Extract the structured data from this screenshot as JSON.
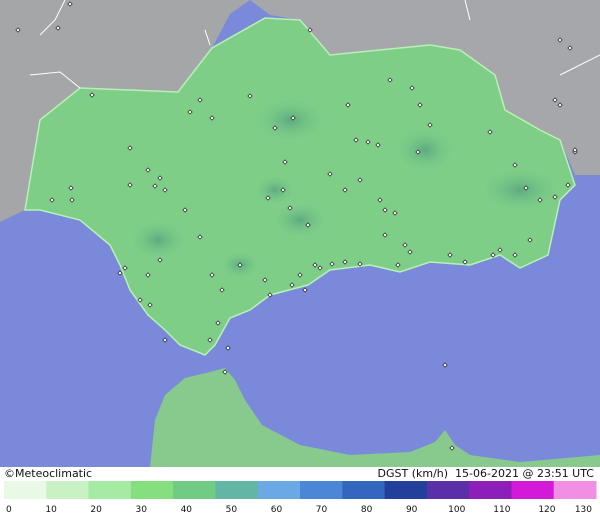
{
  "brand": {
    "name": "Meteoclimatic",
    "copyright_symbol": "©"
  },
  "meta": {
    "variable": "DGST (km/h)",
    "date": "15-06-2021",
    "at": "@",
    "time": "23:51 UTC"
  },
  "legend": {
    "labels": [
      "0",
      "10",
      "20",
      "30",
      "40",
      "50",
      "60",
      "70",
      "80",
      "90",
      "100",
      "110",
      "120",
      "130"
    ],
    "colors": [
      "#e8f9e6",
      "#c8f2c4",
      "#a6eba3",
      "#86df7f",
      "#6fcc82",
      "#61b7a3",
      "#6ba9e4",
      "#4c86d7",
      "#3367bf",
      "#223f9c",
      "#5b2fa7",
      "#8c1fb8",
      "#d21bd8",
      "#f18fe5"
    ]
  },
  "colors": {
    "sea": "#7b89da",
    "land": "#7fce88",
    "land_border": "#b8f0b8",
    "other_land": "#a5a6a8"
  }
}
